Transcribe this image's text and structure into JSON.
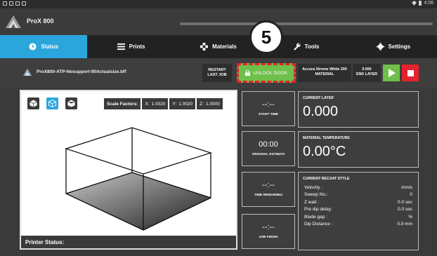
{
  "statusbar": {
    "time": "4:06"
  },
  "app": {
    "title": "ProX 800"
  },
  "tabs": [
    {
      "label": "Status"
    },
    {
      "label": "Prints"
    },
    {
      "label": "Materials"
    },
    {
      "label": "Tools"
    },
    {
      "label": "Settings"
    }
  ],
  "job": {
    "filename": "ProX800-ATP-Nosupport-90Actualsize.bff",
    "restart_l1": "RESTART",
    "restart_l2": "LAST JOB",
    "unlock_label": "UNLOCK DOOR",
    "material_name": "Accura Xtreme White 200",
    "material_label": "MATERIAL",
    "end_layer_value": "0.000",
    "end_layer_label": "END LAYER"
  },
  "callout": {
    "number": "5"
  },
  "viewer": {
    "scale_label": "Scale Factors:",
    "scale_x_label": "X:",
    "scale_x": "1.0020",
    "scale_y_label": "Y:",
    "scale_y": "1.0020",
    "scale_z_label": "Z:",
    "scale_z": "1.0000",
    "printer_status": "Printer Status:"
  },
  "times": [
    {
      "value": "--:--",
      "sub": "-",
      "label": "START TIME"
    },
    {
      "value": "00:00",
      "sub": "-",
      "label": "ORIGINAL ESTIMATI"
    },
    {
      "value": "--:--",
      "sub": "-",
      "label": "TIME REMAINING"
    },
    {
      "value": "--:--",
      "sub": "-",
      "label": "JOB FINISH"
    }
  ],
  "current_layer": {
    "label": "CURRENT LAYER",
    "value": "0.000"
  },
  "material_temp": {
    "label": "MATERIAL TEMPERATURE",
    "value": "0.00°C"
  },
  "recoat": {
    "label": "CURRENT RECOAT STYLE",
    "rows": [
      {
        "k": "Velocity :",
        "v": "mm/s"
      },
      {
        "k": "Sweep No.:",
        "v": "0"
      },
      {
        "k": "Z wait :",
        "v": "0.0 sec"
      },
      {
        "k": "Pre dip delay:",
        "v": "0.0 sec"
      },
      {
        "k": "Blade gap :",
        "v": "%"
      },
      {
        "k": "Dip Distance :",
        "v": "0.0 mm"
      }
    ]
  },
  "colors": {
    "accent": "#2ba6dc",
    "green": "#6fbf4b",
    "red": "#e3232d",
    "panel": "#3e3e3e"
  }
}
